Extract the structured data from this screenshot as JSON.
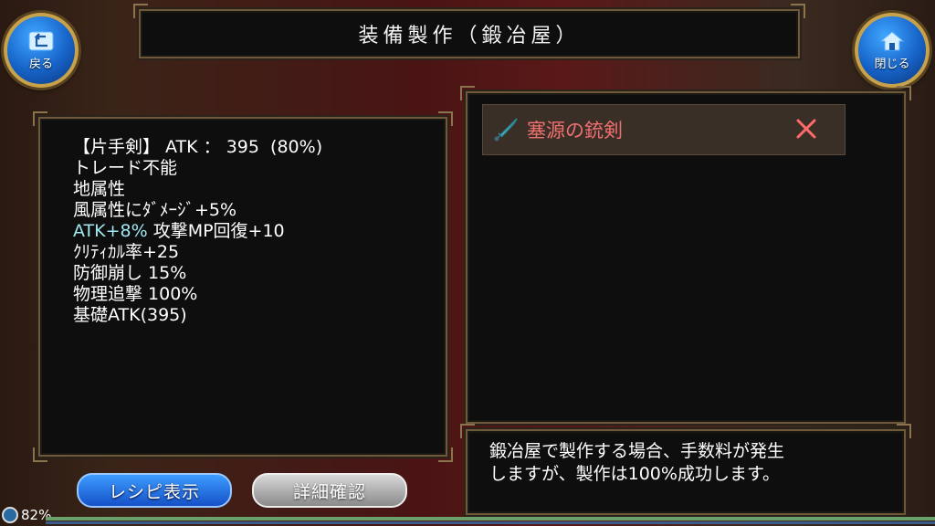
{
  "header": {
    "title": "装備製作（鍛冶屋）",
    "back_label": "戻る",
    "close_label": "閉じる"
  },
  "stats": {
    "line1": "【片手剣】 ATK ： 395  (80%)",
    "line2": "トレード不能",
    "line3": "地属性",
    "line4": "風属性にﾀﾞﾒｰｼﾞ+5%",
    "line5_cyan": "ATK+8%",
    "line5_rest": " 攻撃MP回復+10",
    "line6": "ｸﾘﾃｨｶﾙ率+25",
    "line7": "防御崩し 15%",
    "line8": "物理追撃 100%",
    "line9": "基礎ATK(395)"
  },
  "material": {
    "name": "塞源の銃剣",
    "icon": "sword-icon",
    "remove_icon": "close-x-icon"
  },
  "message": {
    "line1": "鍛冶屋で製作する場合、手数料が発生",
    "line2": "しますが、製作は100%成功します。"
  },
  "buttons": {
    "recipe": "レシピ表示",
    "detail": "詳細確認"
  },
  "status": {
    "battery": "82%"
  },
  "colors": {
    "accent_blue": "#1763c8",
    "item_name_red": "#f07070",
    "cyan_stat": "#9fe8f0",
    "frame_gold": "#c8a24a"
  }
}
